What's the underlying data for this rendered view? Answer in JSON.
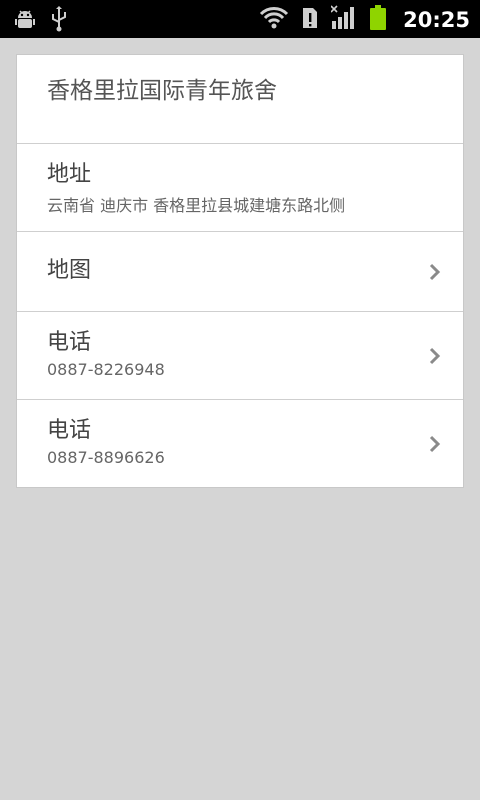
{
  "status_bar": {
    "time": "20:25",
    "icons": [
      "android-debug-icon",
      "usb-icon",
      "wifi-icon",
      "sim-alert-icon",
      "signal-icon",
      "battery-icon"
    ],
    "battery_color": "#8fd400"
  },
  "detail": {
    "name": "香格里拉国际青年旅舍",
    "address_label": "地址",
    "address_value": "云南省 迪庆市 香格里拉县城建塘东路北侧",
    "map_label": "地图",
    "phones": [
      {
        "label": "电话",
        "value": "0887-8226948"
      },
      {
        "label": "电话",
        "value": "0887-8896626"
      }
    ]
  },
  "colors": {
    "background": "#d5d5d5",
    "card": "#ffffff",
    "divider": "#cfcfcf",
    "chevron": "#8a8a8a"
  }
}
